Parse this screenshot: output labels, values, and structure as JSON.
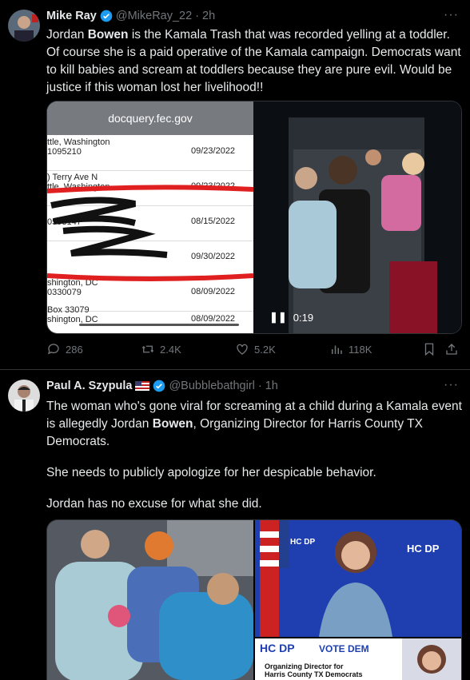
{
  "tweet1": {
    "name": "Mike Ray",
    "handle": "@MikeRay_22",
    "time": "· 2h",
    "text_pre": "Jordan ",
    "text_bold": "Bowen",
    "text_post": " is the Kamala Trash that was recorded yelling at a toddler. Of course she is a paid operative of the Kamala campaign. Democrats want to kill babies and scream at toddlers because they are pure evil. Would be justice if this woman lost her livelihood!!",
    "doc_url": "docquery.fec.gov",
    "doc_rows": [
      {
        "left": "ttle, Washington\n1095210",
        "date": "09/23/2022"
      },
      {
        "left": ") Terry Ave N\nttle, Washington",
        "date": "09/23/2022"
      },
      {
        "left": "\n0593147",
        "date": "08/15/2022"
      },
      {
        "left": "\n",
        "date": "09/30/2022"
      },
      {
        "left": "shington, DC\n0330079",
        "date": "08/09/2022"
      },
      {
        "left": "Box 33079\nshington, DC",
        "date": "08/09/2022"
      }
    ],
    "video_time": "0:19",
    "stats": {
      "replies": "286",
      "reposts": "2.4K",
      "likes": "5.2K",
      "views": "118K"
    }
  },
  "tweet2": {
    "name": "Paul A. Szypula",
    "handle": "@Bubblebathgirl",
    "time": "· 1h",
    "para1_pre": "The woman who's gone viral for screaming at a child during a Kamala event is allegedly Jordan ",
    "para1_bold": "Bowen",
    "para1_post": ", Organizing Director for Harris County TX Democrats.",
    "para2": "She needs to publicly apologize for her despicable behavior.",
    "para3": "Jordan has no excuse for what she did.",
    "banner_text": "HC DP",
    "vote_text": "VOTE DEM",
    "caption_line1": "Organizing Director for",
    "caption_line2": "Harris County TX Democrats"
  },
  "colors": {
    "verified": "#1d9bf0",
    "muted": "#71767b",
    "border": "#2f3336"
  }
}
